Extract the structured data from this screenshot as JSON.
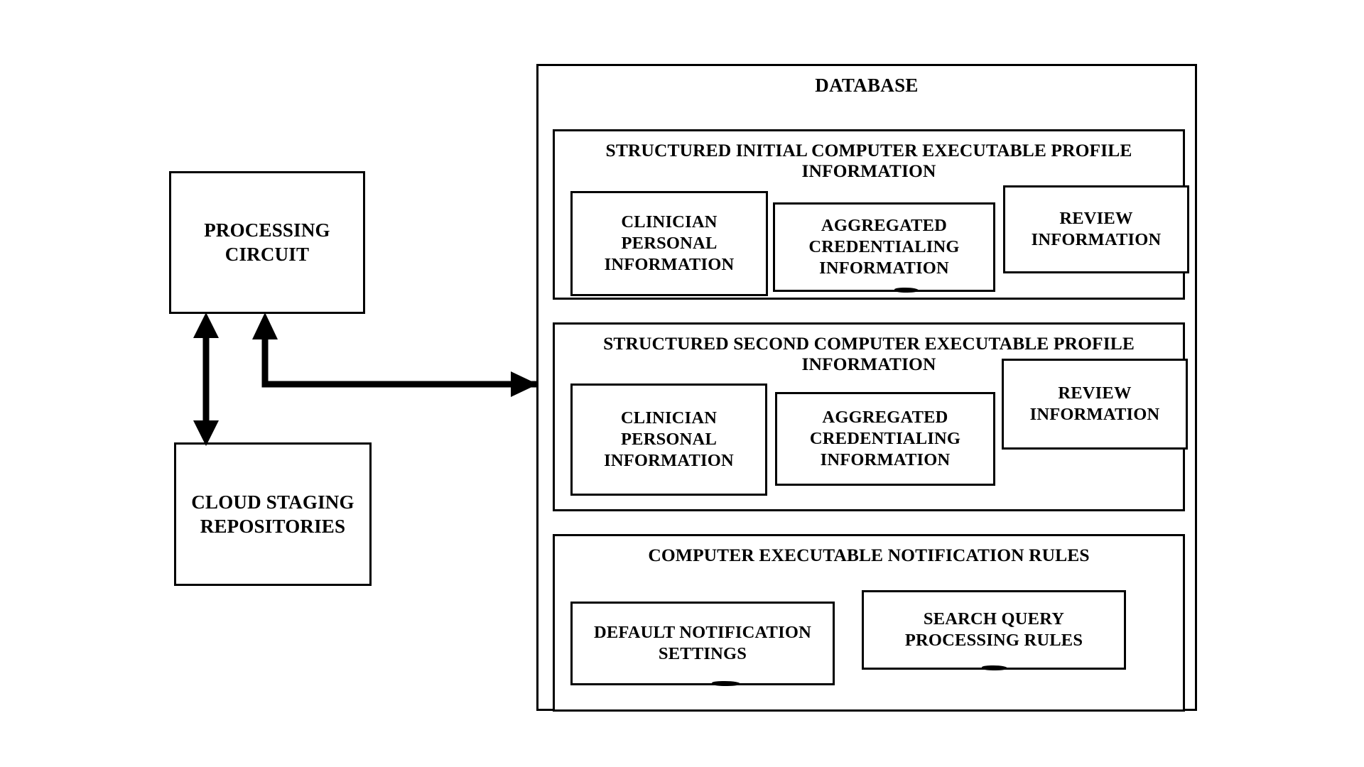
{
  "diagram": {
    "title": "Database Block Diagram",
    "background_color": "#ffffff",
    "line_color": "#000000"
  },
  "left_column": {
    "processing_circuit": {
      "label": "PROCESSING CIRCUIT"
    },
    "cloud_staging": {
      "label": "CLOUD STAGING REPOSITORIES"
    }
  },
  "database": {
    "title": "DATABASE",
    "groups": [
      {
        "id": "initial-profile",
        "title": "STRUCTURED INITIAL COMPUTER EXECUTABLE PROFILE INFORMATION",
        "items": [
          {
            "id": "clinician-personal-information",
            "label": "CLINICIAN PERSONAL INFORMATION"
          },
          {
            "id": "aggregated-credentialing-information",
            "label": "AGGREGATED CREDENTIALING INFORMATION"
          },
          {
            "id": "review-information",
            "label": "REVIEW INFORMATION"
          }
        ]
      },
      {
        "id": "second-profile",
        "title": "STRUCTURED SECOND COMPUTER EXECUTABLE PROFILE INFORMATION",
        "items": [
          {
            "id": "clinician-personal-information",
            "label": "CLINICIAN PERSONAL INFORMATION"
          },
          {
            "id": "aggregated-credentialing-information",
            "label": "AGGREGATED CREDENTIALING INFORMATION"
          },
          {
            "id": "review-information",
            "label": "REVIEW INFORMATION"
          }
        ]
      },
      {
        "id": "notification-rules",
        "title": "COMPUTER EXECUTABLE NOTIFICATION RULES",
        "items": [
          {
            "id": "default-notification-settings",
            "label": "DEFAULT NOTIFICATION SETTINGS"
          },
          {
            "id": "search-query-processing-rules",
            "label": "SEARCH QUERY PROCESSING RULES"
          }
        ]
      }
    ]
  },
  "connectors": [
    {
      "id": "processing-to-cloud",
      "from": "processing-circuit",
      "to": "cloud-staging",
      "style": "double-headed-vertical-arrow"
    },
    {
      "id": "database-to-processing",
      "from": "database",
      "to": "processing-circuit",
      "style": "elbow-arrow-up"
    },
    {
      "id": "processing-to-database",
      "from": "processing-circuit",
      "to": "database",
      "style": "elbow-arrow-right"
    }
  ]
}
